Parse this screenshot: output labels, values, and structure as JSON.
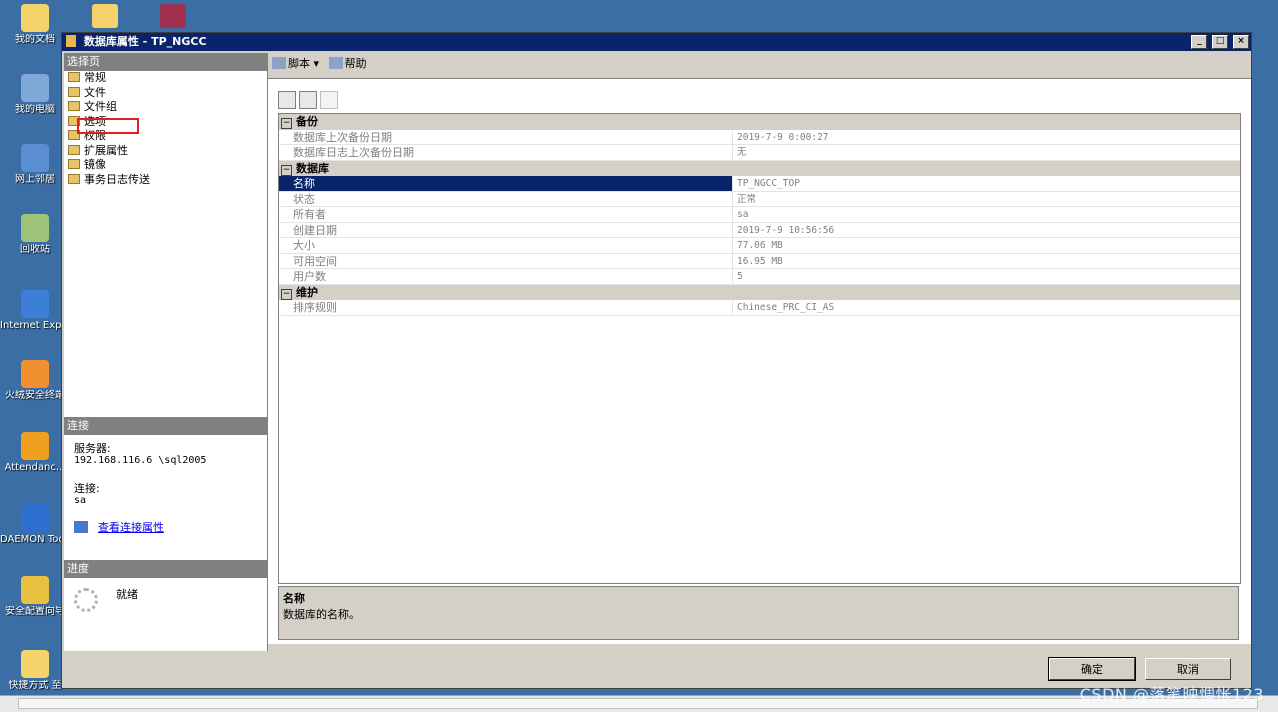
{
  "desktop": {
    "icons": [
      {
        "label": "我的文档",
        "color": "#f4d36a"
      },
      {
        "label": "我的电脑",
        "color": "#7fa8d8"
      },
      {
        "label": "网上邻居",
        "color": "#5a8ed0"
      },
      {
        "label": "回收站",
        "color": "#9ec47a"
      },
      {
        "label": "Internet Explorer",
        "color": "#3c7ed8"
      },
      {
        "label": "火绒安全终端",
        "color": "#f09030"
      },
      {
        "label": "Attendanc...",
        "color": "#f0a020"
      },
      {
        "label": "DAEMON Tools Lite",
        "color": "#2e70d0"
      },
      {
        "label": "安全配置向导",
        "color": "#e8c040"
      },
      {
        "label": "快捷方式 至",
        "color": "#f4d36a"
      }
    ]
  },
  "window": {
    "title": "数据库属性 - TP_NGCC",
    "btn_min": "_",
    "btn_max": "□",
    "btn_close": "×"
  },
  "left": {
    "select_page_header": "选择页",
    "pages": [
      "常规",
      "文件",
      "文件组",
      "选项",
      "权限",
      "扩展属性",
      "镜像",
      "事务日志传送"
    ],
    "connection_header": "连接",
    "server_label": "服务器:",
    "server_value": "192.168.116.6  \\sql2005",
    "connection_label": "连接:",
    "connection_value": "sa",
    "view_link": "查看连接属性",
    "progress_header": "进度",
    "progress_status": "就绪"
  },
  "toolbar": {
    "script": "脚本",
    "help": "帮助"
  },
  "grid": {
    "categories": [
      {
        "name": "备份",
        "rows": [
          {
            "key": "数据库上次备份日期",
            "value": "2019-7-9 0:00:27"
          },
          {
            "key": "数据库日志上次备份日期",
            "value": "无"
          }
        ]
      },
      {
        "name": "数据库",
        "rows": [
          {
            "key": "名称",
            "value": "TP_NGCC_TOP",
            "selected": true
          },
          {
            "key": "状态",
            "value": "正常"
          },
          {
            "key": "所有者",
            "value": "sa"
          },
          {
            "key": "创建日期",
            "value": "2019-7-9 10:56:56"
          },
          {
            "key": "大小",
            "value": "77.06 MB"
          },
          {
            "key": "可用空间",
            "value": "16.95 MB"
          },
          {
            "key": "用户数",
            "value": "5"
          }
        ]
      },
      {
        "name": "维护",
        "rows": [
          {
            "key": "排序规则",
            "value": "Chinese_PRC_CI_AS"
          }
        ]
      }
    ],
    "description_title": "名称",
    "description_text": "数据库的名称。"
  },
  "buttons": {
    "ok": "确定",
    "cancel": "取消"
  },
  "watermark": "CSDN @落笔映惆怅123"
}
